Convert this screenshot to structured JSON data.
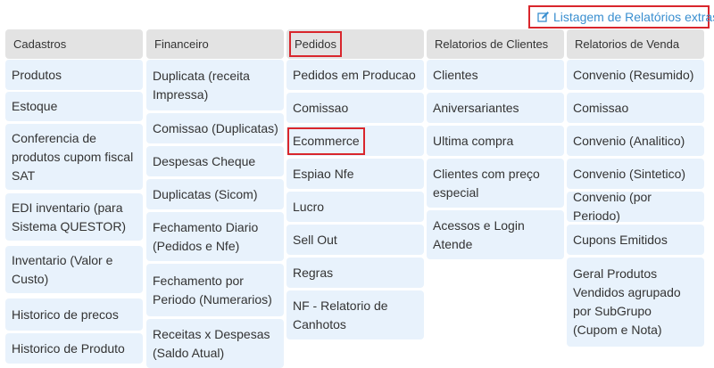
{
  "extras_link": "Listagem de Relatórios extras",
  "columns": [
    {
      "header": "Cadastros",
      "items": [
        "Produtos",
        "Estoque",
        "Conferencia de produtos cupom fiscal SAT",
        "EDI inventario (para Sistema QUESTOR)",
        "Inventario (Valor e Custo)",
        "Historico de precos",
        "Historico de Produto"
      ]
    },
    {
      "header": "Financeiro",
      "items": [
        "Duplicata (receita Impressa)",
        "Comissao (Duplicatas)",
        "Despesas Cheque",
        "Duplicatas (Sicom)",
        "Fechamento Diario (Pedidos e Nfe)",
        "Fechamento por Periodo (Numerarios)",
        "Receitas x Despesas (Saldo Atual)"
      ]
    },
    {
      "header": "Pedidos",
      "items": [
        "Pedidos em Producao",
        "Comissao",
        "Ecommerce",
        "Espiao Nfe",
        "Lucro",
        "Sell Out",
        "Regras",
        "NF - Relatorio de Canhotos"
      ]
    },
    {
      "header": "Relatorios de Clientes",
      "items": [
        "Clientes",
        "Aniversariantes",
        "Ultima compra",
        "Clientes com preço especial",
        "Acessos e Login Atende"
      ]
    },
    {
      "header": "Relatorios de Venda",
      "items": [
        "Convenio (Resumido)",
        "Comissao",
        "Convenio (Analitico)",
        "Convenio (Sintetico)",
        "Convenio (por Periodo)",
        "Cupons Emitidos",
        "Geral Produtos Vendidos agrupado por SubGrupo (Cupom e Nota)"
      ]
    }
  ]
}
